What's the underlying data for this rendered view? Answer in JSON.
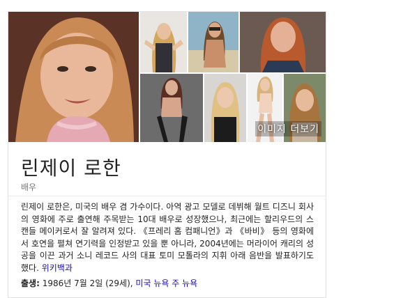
{
  "gallery": {
    "more_images_label": "이미지 더보기",
    "image_alts": [
      "profile-portrait",
      "photo-2",
      "photo-3",
      "photo-4",
      "photo-5",
      "photo-6",
      "photo-7",
      "photo-8"
    ]
  },
  "entity": {
    "name": "린제이 로한",
    "type": "배우"
  },
  "description": {
    "text": "린제이 로한은, 미국의 배우 겸 가수이다. 아역 광고 모델로 데뷔해 월트 디즈니 회사의 영화에 주로 출연해 주목받는 10대 배우로 성장했으나, 최근에는 할리우드의 스캔들 메이커로서 잘 알려져 있다. 《프레리 홈 컴패니언》과 《바비》 등의 영화에서 호연을 펼쳐 연기력을 인정받고 있을 뿐 아니라, 2004년에는 머라이어 캐리의 성공을 이끈 과거 소니 레코드 사의 대표 토미 모톨라의 지휘 아래 음반을 발표하기도 했다.",
    "source_link": "위키백과"
  },
  "facts": {
    "birth_label": "출생:",
    "birth_value": "1986년 7월 2일 (29세),",
    "birth_place_link": "미국 뉴욕 주 뉴욕"
  }
}
